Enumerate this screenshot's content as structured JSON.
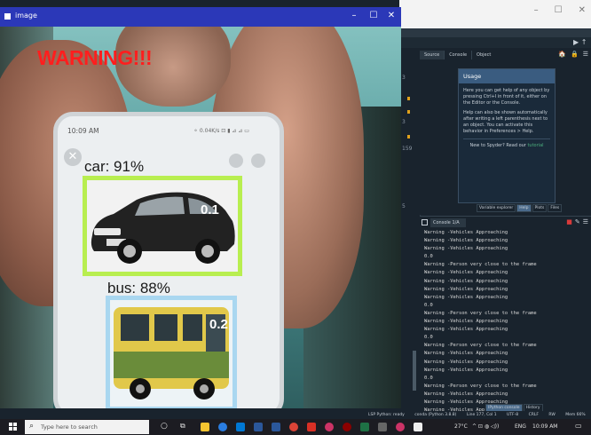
{
  "image_window": {
    "title": "image",
    "controls": {
      "minimize": "–",
      "maximize": "☐",
      "close": "✕"
    },
    "warning_text": "WARNING!!!",
    "phone": {
      "time": "10:09 AM",
      "status_icons": "⚬ 0.04K/s ⊡ ▮ ⊿ ⊿ ▭",
      "close_glyph": "✕"
    },
    "detections": [
      {
        "label": "car: 91%",
        "distance": "0.1",
        "box_color": "#b8ee50"
      },
      {
        "label": "bus: 88%",
        "distance": "0.2",
        "box_color": "#a9d7f0"
      }
    ]
  },
  "spyder": {
    "window_controls": {
      "minimize": "–",
      "maximize": "☐",
      "close": "✕"
    },
    "toolbar_right": "▶ ↑",
    "editor_line_numbers": [
      "3",
      "3",
      "5",
      "159"
    ],
    "help_tabs": [
      "Source",
      "Console",
      "Object"
    ],
    "help_icons": [
      "🏠",
      "🔒",
      "☰"
    ],
    "usage": {
      "title": "Usage",
      "p1": "Here you can get help of any object by pressing Ctrl+I in front of it, either on the Editor or the Console.",
      "p2": "Help can also be shown automatically after writing a left parenthesis next to an object. You can activate this behavior in Preferences > Help.",
      "new_to": "New to Spyder? Read our",
      "tutorial_link": "tutorial"
    },
    "help_bottom_tabs": [
      "Variable explorer",
      "Help",
      "Plots",
      "Files"
    ],
    "console": {
      "tab_label": "Console 1/A",
      "lines": [
        "Warning -Vehicles Approaching",
        "Warning -Vehicles Approaching",
        "Warning -Vehicles Approaching",
        "0.0",
        "Warning -Person very close to the frame",
        "Warning -Vehicles Approaching",
        "Warning -Vehicles Approaching",
        "Warning -Vehicles Approaching",
        "Warning -Vehicles Approaching",
        "0.0",
        "Warning -Person very close to the frame",
        "Warning -Vehicles Approaching",
        "Warning -Vehicles Approaching",
        "0.0",
        "Warning -Person very close to the frame",
        "Warning -Vehicles Approaching",
        "Warning -Vehicles Approaching",
        "Warning -Vehicles Approaching",
        "0.0",
        "Warning -Person very close to the frame",
        "Warning -Vehicles Approaching",
        "Warning -Vehicles Approaching",
        "Warning -Vehicles Approaching"
      ]
    },
    "console_bottom_tabs": [
      "IPython console",
      "History"
    ],
    "statusbar": [
      "LSP Python: ready",
      "conda (Python 3.8.8)",
      "Line 177, Col 1",
      "UTF-8",
      "CRLF",
      "RW",
      "Mem 66%"
    ]
  },
  "taskbar": {
    "search_placeholder": "Type here to search",
    "weather": "27°C",
    "tray_icons": "^ ⊡ ◍ ◁))",
    "language": "ENG",
    "time": "10:09 AM",
    "colors": {
      "edge": "#2a7de1",
      "files": "#f4c430",
      "store": "#0078d4",
      "mail": "#2b579a",
      "chrome": "#db4437",
      "word": "#2b579a",
      "excel": "#1e7145",
      "pdf": "#d93025",
      "settings": "#cc3366",
      "spyder": "#8c0000",
      "terminal": "#444444"
    }
  }
}
